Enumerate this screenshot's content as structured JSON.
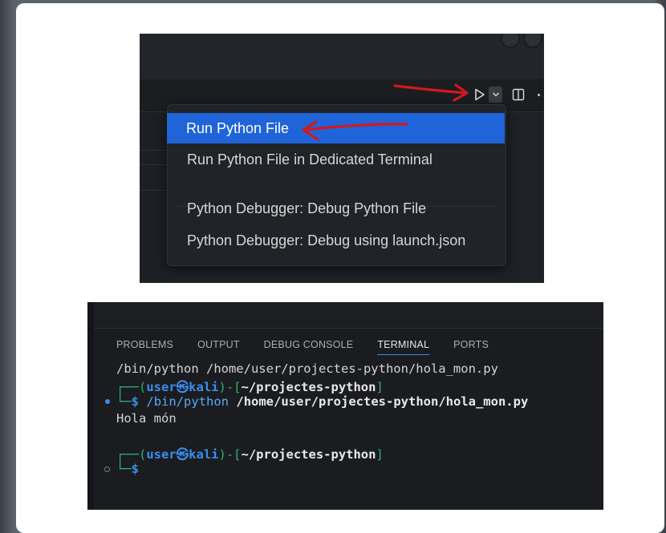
{
  "run_menu": {
    "items": [
      {
        "label": "Run Python File",
        "active": true
      },
      {
        "label": "Run Python File in Dedicated Terminal",
        "active": false
      },
      {
        "label": "Python Debugger: Debug Python File",
        "active": false
      },
      {
        "label": "Python Debugger: Debug using launch.json",
        "active": false
      }
    ],
    "icons": {
      "run": "play-icon",
      "dropdown": "chevron-down-icon",
      "split": "split-editor-icon",
      "more": "more-icon"
    },
    "accent": "#1f64d8",
    "annotation_color": "#d2191e"
  },
  "terminal": {
    "tabs": [
      {
        "label": "PROBLEMS",
        "active": false
      },
      {
        "label": "OUTPUT",
        "active": false
      },
      {
        "label": "DEBUG CONSOLE",
        "active": false
      },
      {
        "label": "TERMINAL",
        "active": true
      },
      {
        "label": "PORTS",
        "active": false
      }
    ],
    "command_echo": "/bin/python /home/user/projectes-python/hola_mon.py",
    "prompt1": {
      "open": "┌──(",
      "user": "user",
      "at": "㉿",
      "host": "kali",
      "mid": ")-[",
      "path": "~/projectes-python",
      "close": "]"
    },
    "cmd_line": {
      "corner": "└─",
      "symbol": "$",
      "exe": "/bin/python",
      "arg": "/home/user/projectes-python/hola_mon.py"
    },
    "output": "Hola món",
    "prompt2": {
      "open": "┌──(",
      "user": "user",
      "at": "㉿",
      "host": "kali",
      "mid": ")-[",
      "path": "~/projectes-python",
      "close": "]"
    },
    "cmd_line2": {
      "corner": "└─",
      "symbol": "$"
    }
  }
}
